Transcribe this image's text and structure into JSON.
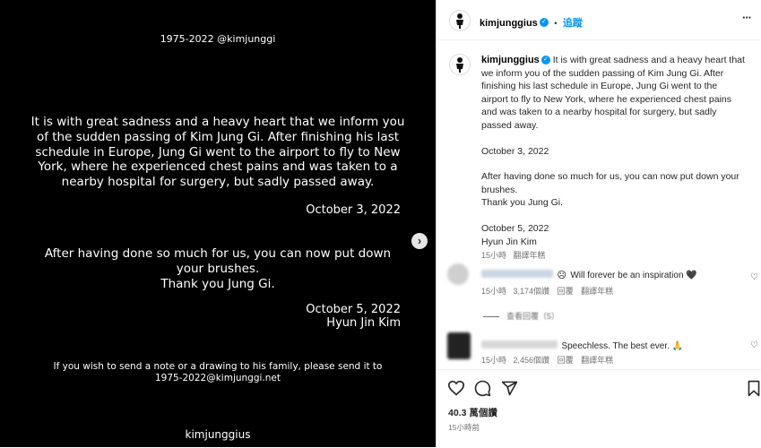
{
  "image_text": {
    "header": "1975-2022 @kimjunggi",
    "para1_lines": [
      "It is with great sadness and a heavy heart that we inform you",
      "of the sudden passing of Kim Jung Gi. After finishing his last",
      "schedule in Europe, Jung Gi went to the airport to fly to New",
      "York, where he experienced chest pains and was taken to a",
      "nearby hospital for surgery, but sadly passed away."
    ],
    "date1": "October 3, 2022",
    "para2_lines": [
      "After having done so much for us, you can now put down",
      "your brushes.",
      "Thank you Jung Gi."
    ],
    "date2": "October 5, 2022",
    "signature": "Hyun Jin Kim",
    "note_lines": [
      "If you wish to send a note or a drawing to his family, please send it to",
      "1975-2022@kimjunggi.net"
    ],
    "footer_name": "kimjunggius"
  },
  "header": {
    "username": "kimjunggius",
    "dot": "•",
    "follow_label": "追蹤",
    "more_label": "···"
  },
  "caption": {
    "username": "kimjunggius",
    "text": "It is with great sadness and a heavy heart that we inform you of the sudden passing of Kim Jung Gi. After finishing his last schedule in Europe, Jung Gi went to the airport to fly to New York, where he experienced chest pains and was taken to a nearby hospital for surgery, but sadly passed away.",
    "date1": "October 3, 2022",
    "para2": "After having done so much for us, you can now put down your brushes.",
    "thanks": "Thank you Jung Gi.",
    "date2": "October 5, 2022",
    "signature": "Hyun Jin Kim",
    "time": "15小時",
    "translate": "翻譯年糕"
  },
  "comments": [
    {
      "text": "Will forever be an inspiration 🖤",
      "time": "15小時",
      "likes": "3,174個讚",
      "reply": "回覆",
      "translate": "翻譯年糕",
      "view_replies": "查看回覆（5）"
    },
    {
      "text": "Speechless. The best ever. 🙏",
      "time": "15小時",
      "likes": "2,456個讚",
      "reply": "回覆",
      "translate": "翻譯年糕"
    }
  ],
  "footer": {
    "likes": "40.3 萬個讚",
    "time": "15小時前"
  },
  "colors": {
    "accent": "#0095f6",
    "image_bg": "#000000"
  }
}
